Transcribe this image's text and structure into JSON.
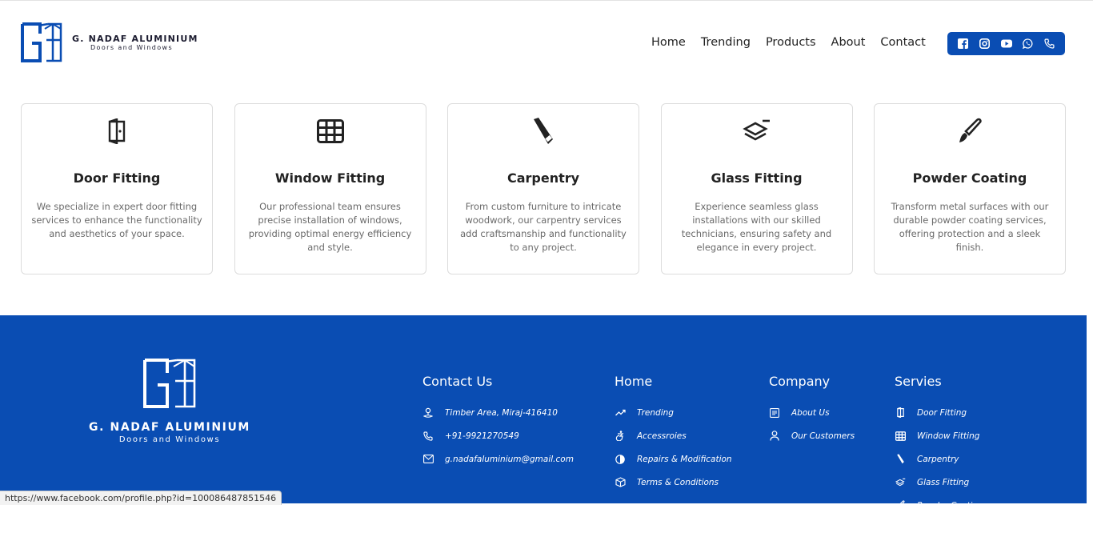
{
  "brand": {
    "name": "G. NADAF ALUMINIUM",
    "tagline": "Doors and Windows"
  },
  "nav": {
    "items": [
      "Home",
      "Trending",
      "Products",
      "About",
      "Contact"
    ]
  },
  "social": {
    "icons": [
      "facebook-icon",
      "instagram-icon",
      "youtube-icon",
      "whatsapp-icon",
      "phone-icon"
    ]
  },
  "services": [
    {
      "title": "Door Fitting",
      "icon": "door-icon",
      "desc": "We specialize in expert door fitting services to enhance the functionality and aesthetics of your space."
    },
    {
      "title": "Window Fitting",
      "icon": "window-grid-icon",
      "desc": "Our professional team ensures precise installation of windows, providing optimal energy efficiency and style."
    },
    {
      "title": "Carpentry",
      "icon": "saw-icon",
      "desc": "From custom furniture to intricate woodwork, our carpentry services add craftsmanship and functionality to any project."
    },
    {
      "title": "Glass Fitting",
      "icon": "layers-icon",
      "desc": "Experience seamless glass installations with our skilled technicians, ensuring safety and elegance in every project."
    },
    {
      "title": "Powder Coating",
      "icon": "brush-icon",
      "desc": "Transform metal surfaces with our durable powder coating services, offering protection and a sleek finish."
    }
  ],
  "footer": {
    "contact": {
      "heading": "Contact Us",
      "items": [
        "Timber Area, Miraj-416410",
        "+91-9921270549",
        "g.nadafaluminium@gmail.com"
      ]
    },
    "home": {
      "heading": "Home",
      "items": [
        "Trending",
        "Accessroies",
        "Repairs & Modification",
        "Terms & Conditions"
      ]
    },
    "company": {
      "heading": "Company",
      "items": [
        "About Us",
        "Our Customers"
      ]
    },
    "services": {
      "heading": "Servies",
      "items": [
        "Door Fitting",
        "Window Fitting",
        "Carpentry",
        "Glass Fitting",
        "Powder Coating"
      ]
    }
  },
  "status_bar": {
    "url": "https://www.facebook.com/profile.php?id=100086487851546"
  },
  "colors": {
    "brand_blue": "#0a4db3",
    "text_dark": "#222222",
    "text_muted": "#6a6a6a"
  }
}
